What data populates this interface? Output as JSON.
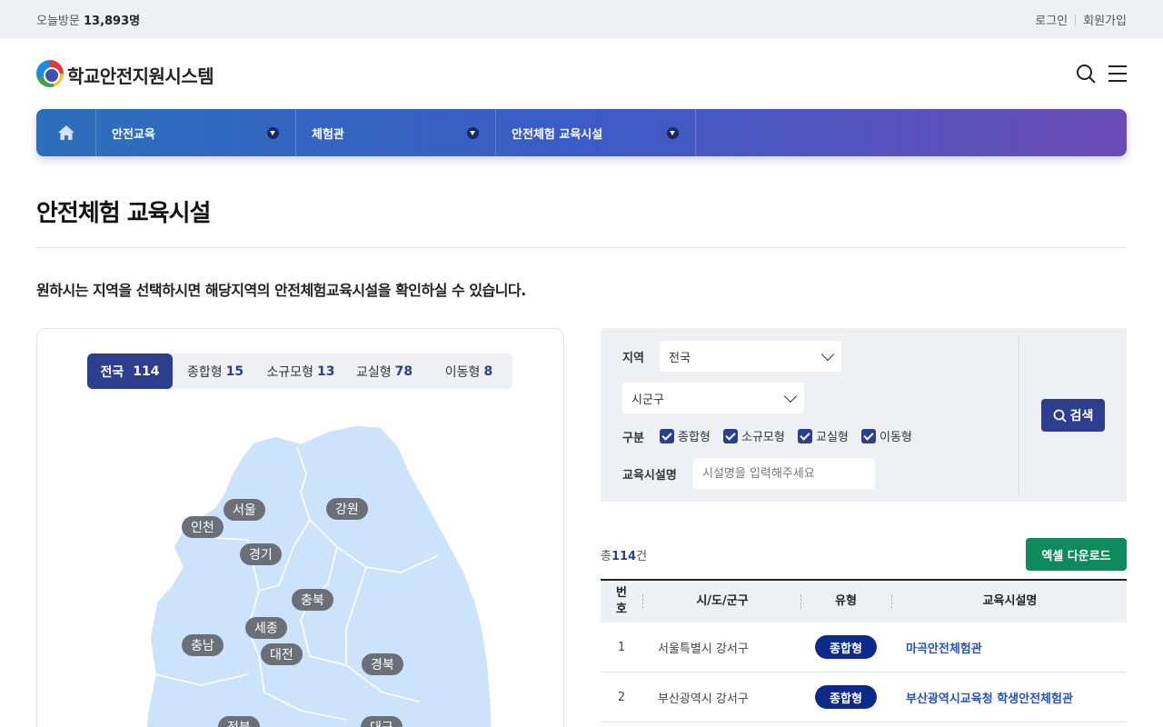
{
  "topbar": {
    "visit_label": "오늘방문",
    "visit_count": "13,893명",
    "login": "로그인",
    "signup": "회원가입"
  },
  "header": {
    "site_title": "학교안전지원시스템"
  },
  "gnb": {
    "items": [
      {
        "label": "안전교육"
      },
      {
        "label": "체험관"
      },
      {
        "label": "안전체험 교육시설"
      }
    ]
  },
  "page": {
    "title": "안전체험 교육시설",
    "description": "원하시는 지역을 선택하시면 해당지역의 안전체험교육시설을 확인하실 수 있습니다."
  },
  "tabs": [
    {
      "label": "전국",
      "count": "114"
    },
    {
      "label": "종합형",
      "count": "15"
    },
    {
      "label": "소규모형",
      "count": "13"
    },
    {
      "label": "교실형",
      "count": "78"
    },
    {
      "label": "이동형",
      "count": "8"
    }
  ],
  "regions": [
    "서울",
    "인천",
    "경기",
    "강원",
    "충북",
    "세종",
    "충남",
    "대전",
    "경북",
    "전북",
    "대구"
  ],
  "search": {
    "region_label": "지역",
    "region_value": "전국",
    "district_value": "시군구",
    "type_label": "구분",
    "types": [
      "종합형",
      "소규모형",
      "교실형",
      "이동형"
    ],
    "name_label": "교육시설명",
    "name_placeholder": "시설명을 입력해주세요",
    "button": "검색"
  },
  "results": {
    "total_prefix": "총",
    "total": "114",
    "total_suffix": "건",
    "excel_button": "엑셀 다운로드"
  },
  "table": {
    "headers": [
      "번호",
      "시/도/군구",
      "유형",
      "교육시설명"
    ],
    "rows": [
      {
        "no": "1",
        "region": "서울특별시 강서구",
        "type": "종합형",
        "name": "마곡안전체험관"
      },
      {
        "no": "2",
        "region": "부산광역시 강서구",
        "type": "종합형",
        "name": "부산광역시교육청 학생안전체험관"
      }
    ]
  },
  "colors": {
    "primary": "#2d3e8e",
    "excel": "#0f8a5f",
    "badge": "#0d2a8a",
    "link": "#2850b8",
    "map_fill": "#cde3fb"
  }
}
